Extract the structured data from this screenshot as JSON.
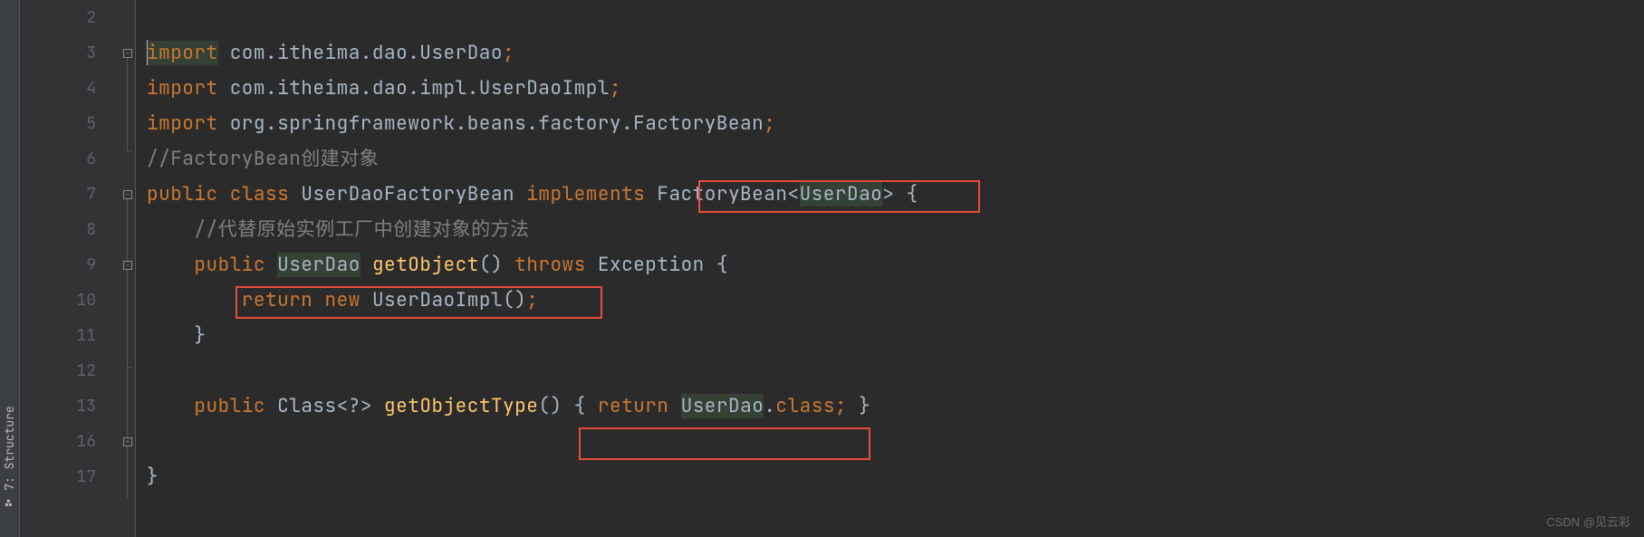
{
  "sidebar": {
    "structure_label": "7: Structure"
  },
  "gutter": {
    "lines": [
      "2",
      "3",
      "4",
      "5",
      "6",
      "7",
      "8",
      "9",
      "10",
      "11",
      "12",
      "13",
      "16",
      "17"
    ]
  },
  "code": {
    "line2": "",
    "line3": {
      "kw": "import",
      "pkg": " com.itheima.dao.UserDao",
      "semi": ";"
    },
    "line4": {
      "kw": "import",
      "pkg": " com.itheima.dao.impl.UserDaoImpl",
      "semi": ";"
    },
    "line5": {
      "kw": "import",
      "pkg": " org.springframework.beans.factory.FactoryBean",
      "semi": ";"
    },
    "line6": {
      "comment": "//FactoryBean创建对象"
    },
    "line7": {
      "kw1": "public",
      "kw2": "class",
      "name": "UserDaoFactoryBean",
      "kw3": "implements",
      "type": "FactoryBean",
      "lt": "<",
      "param": "UserDao",
      "gt": ">",
      "brace": "{"
    },
    "line8": {
      "comment": "//代替原始实例工厂中创建对象的方法"
    },
    "line9": {
      "kw1": "public",
      "ret": "UserDao",
      "method": "getObject",
      "parens": "()",
      "kw2": "throws",
      "exc": "Exception",
      "brace": "{"
    },
    "line10": {
      "kw1": "return",
      "kw2": "new",
      "ctor": "UserDaoImpl",
      "parens": "()",
      "semi": ";"
    },
    "line11": {
      "brace": "}"
    },
    "line12": "",
    "line13": {
      "kw1": "public",
      "ret": "Class",
      "gen": "<?>",
      "method": "getObjectType",
      "parens": "()",
      "brace1": "{",
      "kw2": "return",
      "cls": "UserDao",
      "dot": ".",
      "kw3": "class",
      "semi": ";",
      "brace2": "}"
    },
    "line17": {
      "brace": "}"
    }
  },
  "watermark": "CSDN @见云彩"
}
